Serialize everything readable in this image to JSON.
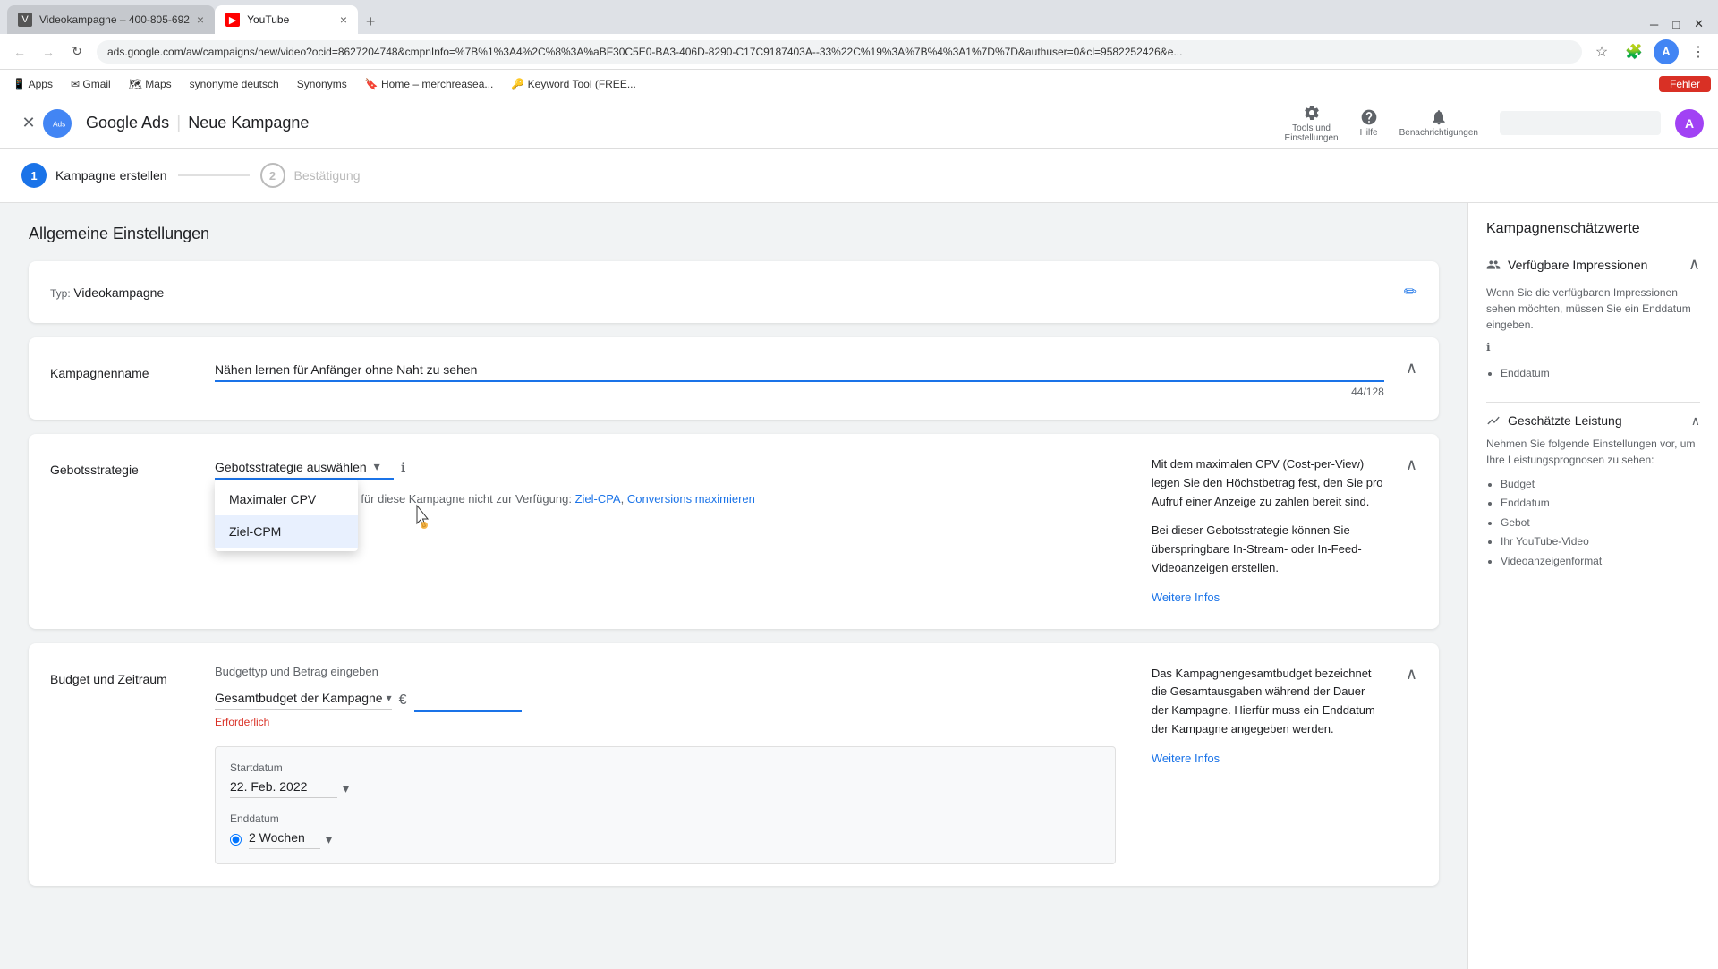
{
  "browser": {
    "tabs": [
      {
        "id": "tab1",
        "title": "Videokampagne – 400-805-692",
        "active": false,
        "favicon": "V"
      },
      {
        "id": "tab2",
        "title": "YouTube",
        "active": true,
        "favicon": "▶"
      }
    ],
    "address": "ads.google.com/aw/campaigns/new/video?ocid=8627204748&cmpnInfo=%7B%1%3A4%2C%8%3A%aBF30C5E0-BA3-406D-8290-C17C9187403A--33%22C%19%3A%7B%4%3A1%7D%7D&authuser=0&cl=9582252426&e...",
    "bookmarks": [
      "Apps",
      "Gmail",
      "Maps",
      "synonyme deutsch",
      "Synonyms",
      "Home – merchreasea...",
      "Keyword Tool (FREE..."
    ],
    "error_btn": "Fehler"
  },
  "header": {
    "logo_text": "Google Ads",
    "page_title": "Neue Kampagne",
    "tools_label": "Tools und\nEinstellungen",
    "help_label": "Hilfe",
    "notifications_label": "Benachrichtigungen",
    "user_initial": "A"
  },
  "stepper": {
    "steps": [
      {
        "number": "1",
        "label": "Kampagne erstellen",
        "active": true
      },
      {
        "number": "2",
        "label": "Bestätigung",
        "active": false
      }
    ]
  },
  "main": {
    "section_title": "Allgemeine Einstellungen",
    "type_card": {
      "label": "Typ:",
      "value": "Videokampagne"
    },
    "campaign_name_card": {
      "field_label": "Kampagnenname",
      "value": "Nähen lernen für Anfänger ohne Naht zu sehen",
      "char_count": "44/128"
    },
    "bid_strategy_card": {
      "field_label": "Gebotsstrategie",
      "dropdown_label": "Gebotsstrategie auswählen",
      "info_icon": "ℹ",
      "dropdown_options": [
        {
          "id": "opt1",
          "label": "Maximaler CPV",
          "selected": true
        },
        {
          "id": "opt2",
          "label": "Ziel-CPM",
          "selected": false,
          "hovered": true
        }
      ],
      "unavailable_text": "Folgende Strategien stehen für diese Kampagne nicht zur Verfügung:",
      "unavailable_link1": "Ziel-CPA",
      "unavailable_link2": "Conversions maximieren",
      "info_title": "Mit dem maximalen CPV (Cost-per-View) legen Sie den Höchstbetrag fest, den Sie pro Aufruf einer Anzeige zu zahlen bereit sind.",
      "info_body": "Bei dieser Gebotsstrategie können Sie überspringbare In-Stream- oder In-Feed-Videoanzeigen erstellen.",
      "info_link": "Weitere Infos"
    },
    "budget_card": {
      "field_label": "Budget und Zeitraum",
      "budget_type_label": "Budgettyp und Betrag eingeben",
      "budget_dropdown_label": "Gesamtbudget der Kampagne",
      "budget_dropdown_arrow": "▾",
      "currency_symbol": "€",
      "required_text": "Erforderlich",
      "start_date_label": "Startdatum",
      "start_date_value": "22. Feb. 2022",
      "end_date_label": "Enddatum",
      "end_date_option": "2 Wochen",
      "info_title": "Das Kampagnengesamtbudget bezeichnet die Gesamtausgaben während der Dauer der Kampagne. Hierfür muss ein Enddatum der Kampagne angegeben werden.",
      "info_link": "Weitere Infos"
    }
  },
  "sidebar": {
    "title": "Kampagnenschätzwerte",
    "sections": [
      {
        "id": "impressions",
        "icon": "👥",
        "title": "Verfügbare Impressionen",
        "expanded": true,
        "text": "Wenn Sie die verfügbaren Impressionen sehen möchten, müssen Sie ein Enddatum eingeben.",
        "info_icon": "ℹ",
        "subsection": {
          "label": "Enddatum"
        }
      },
      {
        "id": "performance",
        "icon": "📈",
        "title": "Geschätzte Leistung",
        "expanded": true,
        "text": "Nehmen Sie folgende Einstellungen vor, um Ihre Leistungsprognosen zu sehen:",
        "list_items": [
          "Budget",
          "Enddatum",
          "Gebot",
          "Ihr YouTube-Video",
          "Videoanzeigenformat"
        ]
      }
    ]
  }
}
